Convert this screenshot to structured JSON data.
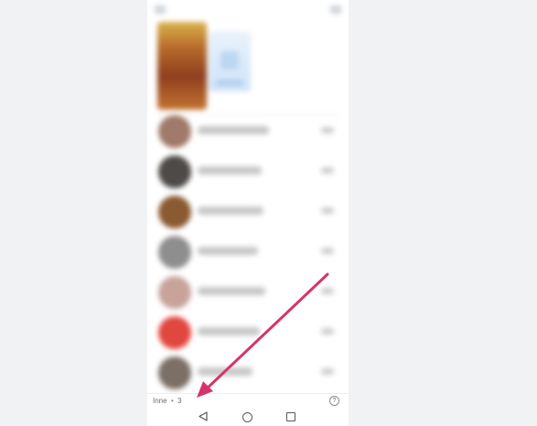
{
  "bottom_bar": {
    "others_label": "Inne",
    "separator": "•",
    "others_count": "3",
    "help_icon_glyph": "?"
  },
  "conversations": [
    {
      "avatar_color": "#a07a6a"
    },
    {
      "avatar_color": "#4d4a47"
    },
    {
      "avatar_color": "#8a5a32"
    },
    {
      "avatar_color": "#8e8e8e"
    },
    {
      "avatar_color": "#c7a39a"
    },
    {
      "avatar_color": "#e0473f"
    },
    {
      "avatar_color": "#7b6f66"
    }
  ],
  "nav_buttons": [
    "back-icon",
    "home-icon",
    "recent-apps-icon"
  ],
  "colors": {
    "background": "#f1f2f4",
    "annotation_arrow": "#d6336c",
    "hero_card": "#cfe3f7"
  }
}
